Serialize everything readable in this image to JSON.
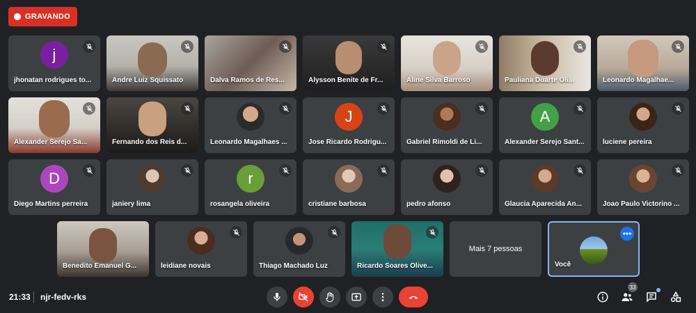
{
  "recording": {
    "label": "GRAVANDO"
  },
  "participants": [
    {
      "name": "jhonatan rodrigues to...",
      "avatar_letter": "j",
      "avatar_color": "#7b1fa2"
    },
    {
      "name": "Andre Luiz Squissato"
    },
    {
      "name": "Dalva Ramos de Res..."
    },
    {
      "name": "Alysson Benite de Fr..."
    },
    {
      "name": "Aline Silva Barroso"
    },
    {
      "name": "Pauliana Duarte Oli..."
    },
    {
      "name": "Leonardo Magalhae..."
    },
    {
      "name": "Alexander Serejo Sa..."
    },
    {
      "name": "Fernando dos Reis d..."
    },
    {
      "name": "Leonardo Magalhaes ..."
    },
    {
      "name": "Jose Ricardo Rodrigu...",
      "avatar_letter": "J",
      "avatar_color": "#d84315"
    },
    {
      "name": "Gabriel Rimoldi de Li..."
    },
    {
      "name": "Alexander Serejo Sant...",
      "avatar_letter": "A",
      "avatar_color": "#43a047"
    },
    {
      "name": "luciene pereira"
    },
    {
      "name": "Diego Martins perreira",
      "avatar_letter": "D",
      "avatar_color": "#ab47bc"
    },
    {
      "name": "janiery lima"
    },
    {
      "name": "rosangela oliveira",
      "avatar_letter": "r",
      "avatar_color": "#689f38"
    },
    {
      "name": "cristiane barbosa"
    },
    {
      "name": "pedro afonso"
    },
    {
      "name": "Glaucia Aparecida An..."
    },
    {
      "name": "Joao Paulo Victorino ..."
    },
    {
      "name": "Benedito Emanuel G..."
    },
    {
      "name": "leidiane novais"
    },
    {
      "name": "Thiago Machado Luz"
    },
    {
      "name": "Ricardo Soares Olive..."
    }
  ],
  "more_tile": {
    "label": "Mais 7 pessoas"
  },
  "self_tile": {
    "name": "Você"
  },
  "bottom_bar": {
    "time": "21:33",
    "meeting_code": "njr-fedv-rks",
    "participant_count": "33"
  },
  "colors": {
    "background": "#202124",
    "tile": "#3c4043",
    "recording": "#d93025",
    "end_call": "#ea4335",
    "self_border": "#8ab4f8"
  }
}
